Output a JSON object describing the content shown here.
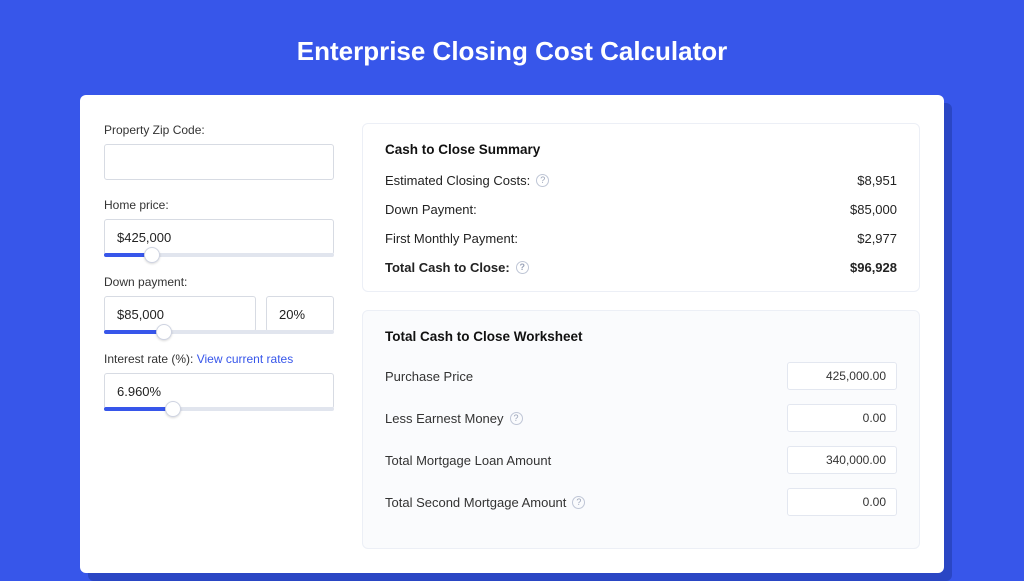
{
  "page_title": "Enterprise Closing Cost Calculator",
  "left": {
    "zip_label": "Property Zip Code:",
    "zip_value": "",
    "home_price_label": "Home price:",
    "home_price_value": "$425,000",
    "home_price_slider_pct": 21,
    "down_payment_label": "Down payment:",
    "down_payment_value": "$85,000",
    "down_payment_pct_value": "20%",
    "down_payment_slider_pct": 26,
    "interest_label": "Interest rate (%):",
    "interest_link": "View current rates",
    "interest_value": "6.960%",
    "interest_slider_pct": 30
  },
  "summary": {
    "title": "Cash to Close Summary",
    "rows": [
      {
        "label": "Estimated Closing Costs:",
        "help": true,
        "value": "$8,951"
      },
      {
        "label": "Down Payment:",
        "help": false,
        "value": "$85,000"
      },
      {
        "label": "First Monthly Payment:",
        "help": false,
        "value": "$2,977"
      }
    ],
    "total_label": "Total Cash to Close:",
    "total_value": "$96,928"
  },
  "worksheet": {
    "title": "Total Cash to Close Worksheet",
    "rows": [
      {
        "label": "Purchase Price",
        "help": false,
        "value": "425,000.00"
      },
      {
        "label": "Less Earnest Money",
        "help": true,
        "value": "0.00"
      },
      {
        "label": "Total Mortgage Loan Amount",
        "help": false,
        "value": "340,000.00"
      },
      {
        "label": "Total Second Mortgage Amount",
        "help": true,
        "value": "0.00"
      }
    ]
  }
}
